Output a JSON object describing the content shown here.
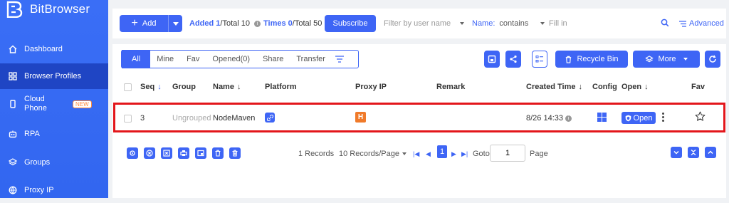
{
  "app": {
    "name": "BitBrowser"
  },
  "sidebar": {
    "items": [
      {
        "label": "Dashboard",
        "icon": "home-icon"
      },
      {
        "label": "Browser Profiles",
        "icon": "grid-icon",
        "active": true
      },
      {
        "label": "Cloud Phone",
        "icon": "phone-icon",
        "badge": "NEW"
      },
      {
        "label": "RPA",
        "icon": "robot-icon"
      },
      {
        "label": "Groups",
        "icon": "layers-icon"
      },
      {
        "label": "Proxy IP",
        "icon": "globe-icon"
      }
    ]
  },
  "toolbar": {
    "add_label": "Add",
    "added_label": "Added",
    "added_count": "1",
    "added_total": "/Total 10",
    "times_label": "Times",
    "times_count": "0",
    "times_total": "/Total 50",
    "subscribe_label": "Subscribe",
    "filter_user_placeholder": "Filter by user name",
    "name_label": "Name:",
    "name_mode": "contains",
    "fill_placeholder": "Fill in",
    "advanced_label": "Advanced"
  },
  "tabs": [
    "All",
    "Mine",
    "Fav",
    "Opened(0)",
    "Share",
    "Transfer"
  ],
  "actions": {
    "recycle_label": "Recycle Bin",
    "more_label": "More"
  },
  "table": {
    "headers": {
      "seq": "Seq",
      "group": "Group",
      "name": "Name",
      "platform": "Platform",
      "proxy_ip": "Proxy IP",
      "remark": "Remark",
      "created_time": "Created Time",
      "config": "Config",
      "open": "Open",
      "fav": "Fav"
    },
    "rows": [
      {
        "seq": "3",
        "group": "Ungrouped",
        "name": "NodeMaven",
        "proxy_badge": "H",
        "remark": "",
        "created_time": "8/26 14:33",
        "open_label": "Open"
      }
    ]
  },
  "pagination": {
    "records": "1 Records",
    "per_page": "10 Records/Page",
    "current_page": "1",
    "goto_label": "Goto",
    "goto_value": "1",
    "page_label": "Page"
  },
  "colors": {
    "accent": "#3e65f5",
    "sidebar": "#3266f0",
    "highlight": "#e3161b",
    "proxy_badge": "#f07a2a"
  }
}
